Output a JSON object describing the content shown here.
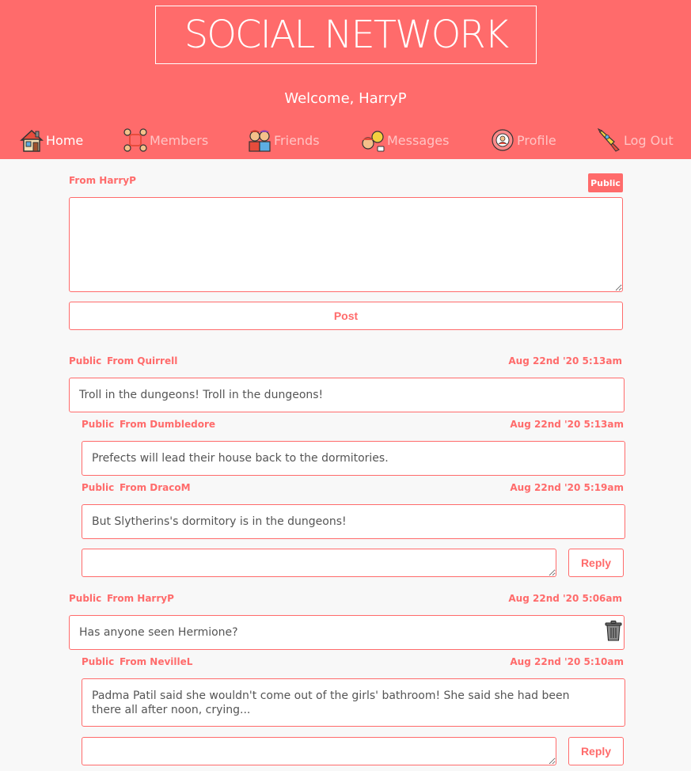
{
  "header": {
    "logo": "SOCIAL NETWORK",
    "welcome": "Welcome, HarryP"
  },
  "nav": [
    {
      "label": "Home",
      "icon": "house-icon",
      "active": true
    },
    {
      "label": "Members",
      "icon": "members-icon",
      "active": false
    },
    {
      "label": "Friends",
      "icon": "friends-icon",
      "active": false
    },
    {
      "label": "Messages",
      "icon": "messages-icon",
      "active": false
    },
    {
      "label": "Profile",
      "icon": "profile-icon",
      "active": false
    },
    {
      "label": "Log Out",
      "icon": "rocket-icon",
      "active": false
    }
  ],
  "compose": {
    "from": "From HarryP",
    "visibility": "Public",
    "post_label": "Post"
  },
  "threads": [
    {
      "visibility": "Public",
      "from": "From Quirrell",
      "date": "Aug 22nd '20 5:13am",
      "text": "Troll in the dungeons! Troll in the dungeons!",
      "replies": [
        {
          "visibility": "Public",
          "from": "From Dumbledore",
          "date": "Aug 22nd '20 5:13am",
          "text": "Prefects will lead their house back to the dormitories."
        },
        {
          "visibility": "Public",
          "from": "From DracoM",
          "date": "Aug 22nd '20 5:19am",
          "text": "But Slytherins's dormitory is in the dungeons!"
        }
      ],
      "reply_label": "Reply"
    },
    {
      "visibility": "Public",
      "from": "From HarryP",
      "date": "Aug 22nd '20 5:06am",
      "text": "Has anyone seen Hermione?",
      "replies": [
        {
          "visibility": "Public",
          "from": "From NevilleL",
          "date": "Aug 22nd '20 5:10am",
          "text": "Padma Patil said she wouldn't come out of the girls' bathroom! She said she had been there all after noon, crying..."
        }
      ],
      "reply_label": "Reply"
    }
  ],
  "colors": {
    "accent": "#ff6b6b",
    "nav_inactive": "#ffc4c4",
    "background": "#f8f8f8"
  }
}
